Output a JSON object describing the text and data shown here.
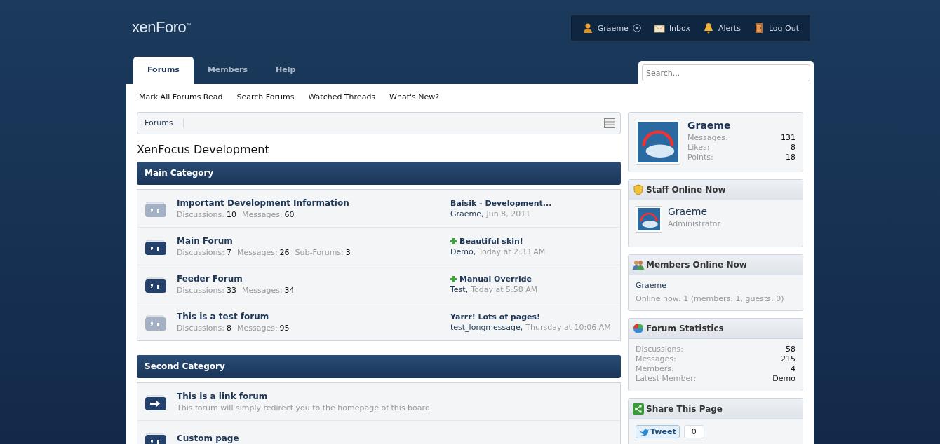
{
  "logo": {
    "text": "xenForo$^{™}$"
  },
  "user_bar": [
    {
      "kind": "user",
      "label": "Graeme"
    },
    {
      "kind": "inbox",
      "label": "Inbox"
    },
    {
      "kind": "alerts",
      "label": "Alerts"
    },
    {
      "kind": "logout",
      "label": "Log Out"
    }
  ],
  "tabs": [
    {
      "label": "Forums",
      "selected": true
    },
    {
      "label": "Members",
      "selected": false
    },
    {
      "label": "Help",
      "selected": false
    }
  ],
  "search": {
    "placeholder": "Search..."
  },
  "sub_nav": [
    "Mark All Forums Read",
    "Search Forums",
    "Watched Threads",
    "What's New?"
  ],
  "breadcrumb": [
    "Forums"
  ],
  "page_title": "XenFocus Development",
  "categories": [
    {
      "title": "Main Category",
      "forums": [
        {
          "kind": "forum",
          "title": "Important Development Information",
          "unread": false,
          "stats": [
            {
              "label": "Discussions:",
              "value": "10"
            },
            {
              "label": "Messages:",
              "value": "60"
            }
          ],
          "last_post": {
            "title": "Baisik - Development...",
            "new": false,
            "user": "Graeme,",
            "time": "Jun 8, 2011"
          }
        },
        {
          "kind": "forum",
          "title": "Main Forum",
          "unread": true,
          "stats": [
            {
              "label": "Discussions:",
              "value": "7"
            },
            {
              "label": "Messages:",
              "value": "26"
            },
            {
              "label": "Sub-Forums:",
              "value": "3"
            }
          ],
          "last_post": {
            "title": "Beautiful skin!",
            "new": true,
            "user": "Demo,",
            "time": "Today at 2:33 AM"
          }
        },
        {
          "kind": "forum",
          "title": "Feeder Forum",
          "unread": true,
          "stats": [
            {
              "label": "Discussions:",
              "value": "33"
            },
            {
              "label": "Messages:",
              "value": "34"
            }
          ],
          "last_post": {
            "title": "Manual Override",
            "new": true,
            "user": "Test,",
            "time": "Today at 5:58 AM"
          }
        },
        {
          "kind": "forum",
          "title": "This is a test forum",
          "unread": false,
          "stats": [
            {
              "label": "Discussions:",
              "value": "8"
            },
            {
              "label": "Messages:",
              "value": "95"
            }
          ],
          "last_post": {
            "title": "Yarrr! Lots of pages!",
            "new": false,
            "user": "test_longmessage,",
            "time": "Thursday at 10:06 AM"
          }
        }
      ]
    },
    {
      "title": "Second Category",
      "forums": [
        {
          "kind": "link",
          "title": "This is a link forum",
          "unread": true,
          "description": "This forum will simply redirect you to the homepage of this board."
        },
        {
          "kind": "page",
          "title": "Custom page",
          "unread": true
        }
      ]
    }
  ],
  "visitor_panel": {
    "name": "Graeme",
    "stats": [
      {
        "label": "Messages:",
        "value": "131"
      },
      {
        "label": "Likes:",
        "value": "8"
      },
      {
        "label": "Points:",
        "value": "18"
      }
    ]
  },
  "staff_online": {
    "title": "Staff Online Now",
    "members": [
      {
        "name": "Graeme",
        "role": "Administrator"
      }
    ]
  },
  "members_online": {
    "title": "Members Online Now",
    "names": [
      "Graeme"
    ],
    "summary": "Online now: 1 (members: 1, guests: 0)"
  },
  "forum_statistics": {
    "title": "Forum Statistics",
    "stats": [
      {
        "label": "Discussions:",
        "value": "58"
      },
      {
        "label": "Messages:",
        "value": "215"
      },
      {
        "label": "Members:",
        "value": "4"
      },
      {
        "label": "Latest Member:",
        "value": "Demo"
      }
    ]
  },
  "share": {
    "title": "Share This Page",
    "tweet_label": "Tweet",
    "tweet_count": "0"
  }
}
